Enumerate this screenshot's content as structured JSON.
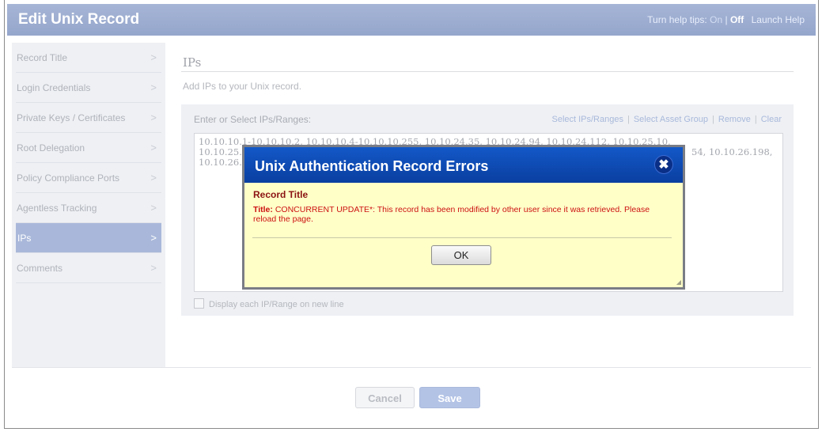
{
  "header": {
    "title": "Edit Unix Record",
    "help_prefix": "Turn help tips:",
    "help_on": "On",
    "help_sep": "|",
    "help_off": "Off",
    "launch_help": "Launch Help"
  },
  "sidebar": {
    "items": [
      {
        "label": "Record Title"
      },
      {
        "label": "Login Credentials"
      },
      {
        "label": "Private Keys / Certificates"
      },
      {
        "label": "Root Delegation"
      },
      {
        "label": "Policy Compliance Ports"
      },
      {
        "label": "Agentless Tracking"
      },
      {
        "label": "IPs"
      },
      {
        "label": "Comments"
      }
    ],
    "chevron": ">"
  },
  "main": {
    "title": "IPs",
    "subtitle": "Add IPs to your Unix record.",
    "field_label": "Enter or Select IPs/Ranges:",
    "links": {
      "select_ips": "Select IPs/Ranges",
      "select_asset_group": "Select Asset Group",
      "remove": "Remove",
      "clear": "Clear",
      "sep": "|"
    },
    "ips_line1": "10.10.10.1-10.10.10.2, 10.10.10.4-10.10.10.255, 10.10.24.35, 10.10.24.94, 10.10.24.112, 10.10.25.10,",
    "ips_line2_start": "10.10.25.",
    "ips_line2_end": "54, 10.10.26.198,",
    "ips_line3_start": "10.10.26.",
    "checkbox_label": "Display each IP/Range on new line"
  },
  "footer": {
    "cancel_label": "Cancel",
    "save_label": "Save"
  },
  "modal": {
    "title": "Unix Authentication Record Errors",
    "close_symbol": "✖",
    "section": "Record Title",
    "error_field": "Title:",
    "error_text": " CONCURRENT UPDATE*: This record has been modified by other user since it was retrieved. Please reload the page.",
    "ok_label": "OK"
  }
}
